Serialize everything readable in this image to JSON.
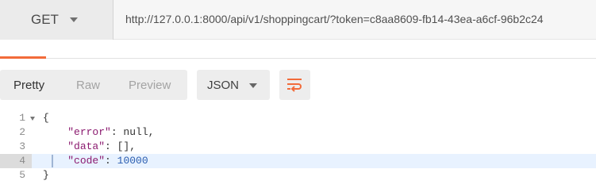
{
  "request": {
    "method": "GET",
    "url": "http://127.0.0.1:8000/api/v1/shoppingcart/?token=c8aa8609-fb14-43ea-a6cf-96b2c24"
  },
  "toolbar": {
    "format_options": [
      "Pretty",
      "Raw",
      "Preview"
    ],
    "selected_format": "Pretty",
    "language": "JSON",
    "wrap_icon": "wrap-lines-icon"
  },
  "response": {
    "active_line": 4,
    "lines": [
      {
        "num": "1",
        "fold": true,
        "parts": [
          {
            "t": "{",
            "c": "punct"
          }
        ]
      },
      {
        "num": "2",
        "fold": false,
        "parts": [
          {
            "t": "    ",
            "c": "punct"
          },
          {
            "t": "\"error\"",
            "c": "key"
          },
          {
            "t": ": null,",
            "c": "punct"
          }
        ]
      },
      {
        "num": "3",
        "fold": false,
        "parts": [
          {
            "t": "    ",
            "c": "punct"
          },
          {
            "t": "\"data\"",
            "c": "key"
          },
          {
            "t": ": [],",
            "c": "punct"
          }
        ]
      },
      {
        "num": "4",
        "fold": false,
        "parts": [
          {
            "t": "    ",
            "c": "punct"
          },
          {
            "t": "\"code\"",
            "c": "key"
          },
          {
            "t": ": ",
            "c": "punct"
          },
          {
            "t": "10000",
            "c": "num"
          }
        ]
      },
      {
        "num": "5",
        "fold": false,
        "parts": [
          {
            "t": "}",
            "c": "punct"
          }
        ]
      }
    ]
  },
  "colors": {
    "accent": "#f26b3a",
    "key": "#8b1a6f",
    "number": "#2a5db0"
  }
}
